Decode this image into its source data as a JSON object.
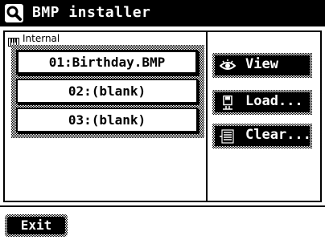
{
  "header": {
    "title": "BMP installer",
    "icon": "magnifier-icon"
  },
  "memory": {
    "label": "Internal",
    "icon": "keyboard-icon"
  },
  "files": [
    {
      "label": "01:Birthday.BMP",
      "selected": true
    },
    {
      "label": "02:(blank)",
      "selected": false
    },
    {
      "label": "03:(blank)",
      "selected": false
    }
  ],
  "actions": {
    "view": {
      "label": "View",
      "icon": "eye-icon"
    },
    "load": {
      "label": "Load...",
      "icon": "floppy-disk-icon"
    },
    "clear": {
      "label": "Clear...",
      "icon": "clear-list-icon"
    }
  },
  "footer": {
    "exit_label": "Exit"
  }
}
